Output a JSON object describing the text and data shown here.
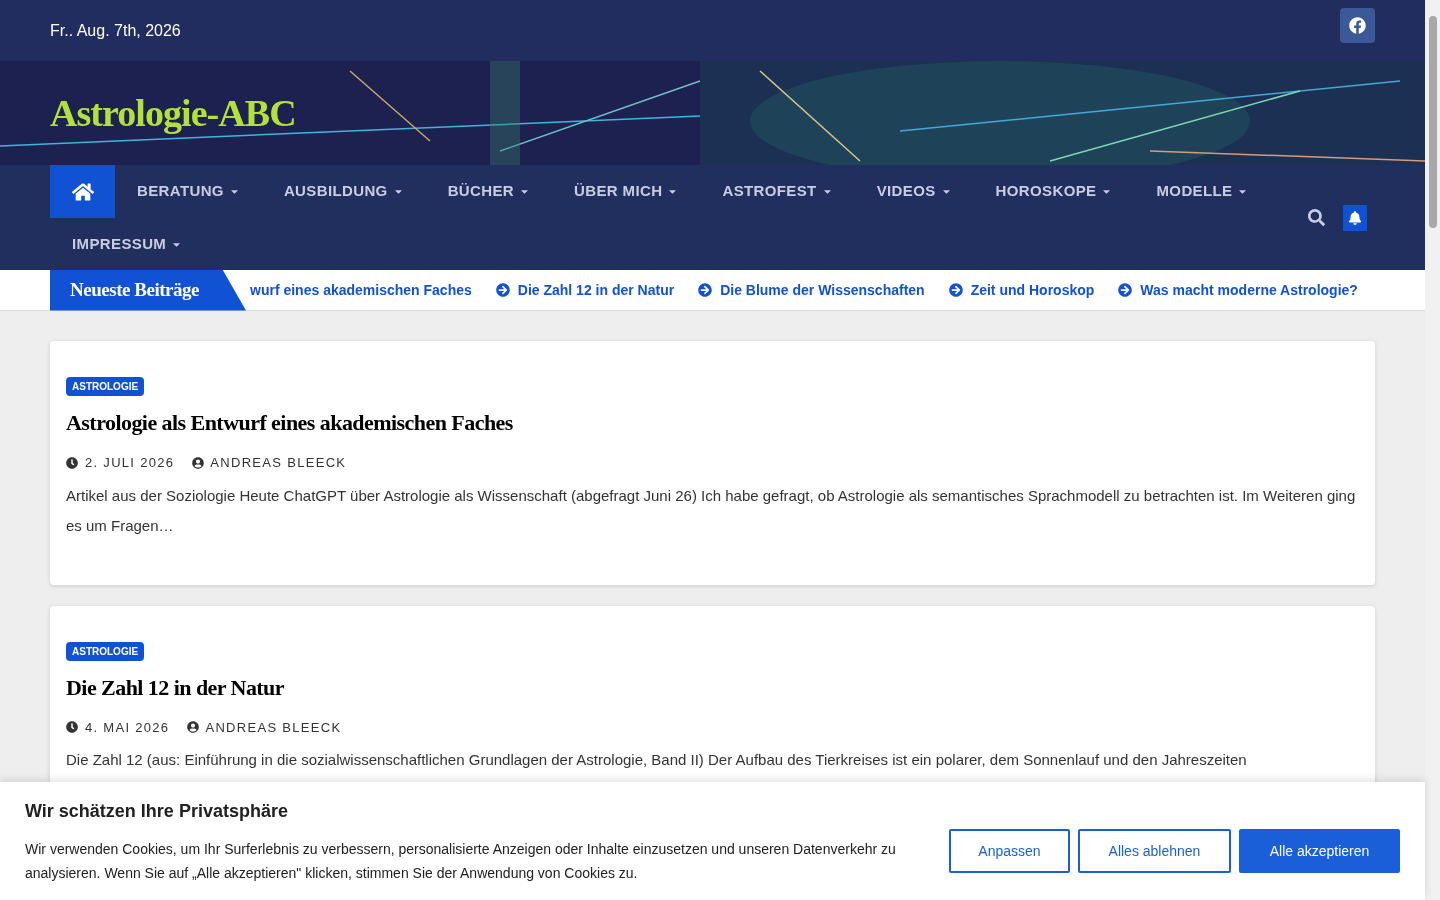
{
  "top_bar": {
    "date": "Fr.. Aug. 7th, 2026"
  },
  "header": {
    "site_title": "Astrologie-ABC"
  },
  "nav": {
    "items": [
      {
        "label": "BERATUNG",
        "has_dropdown": true
      },
      {
        "label": "AUSBILDUNG",
        "has_dropdown": true
      },
      {
        "label": "BÜCHER",
        "has_dropdown": true
      },
      {
        "label": "ÜBER MICH",
        "has_dropdown": true
      },
      {
        "label": "ASTROFEST",
        "has_dropdown": true
      },
      {
        "label": "VIDEOS",
        "has_dropdown": true
      },
      {
        "label": "HOROSKOPE",
        "has_dropdown": true
      },
      {
        "label": "MODELLE",
        "has_dropdown": true
      },
      {
        "label": "IMPRESSUM",
        "has_dropdown": true
      }
    ]
  },
  "ticker": {
    "label": "Neueste Beiträge",
    "items": [
      {
        "text": "wurf eines akademischen Faches",
        "arrow": false
      },
      {
        "text": "Die Zahl 12 in der Natur",
        "arrow": true
      },
      {
        "text": "Die Blume der Wissenschaften",
        "arrow": true
      },
      {
        "text": "Zeit und Horoskop",
        "arrow": true
      },
      {
        "text": "Was macht moderne Astrologie?",
        "arrow": true
      }
    ]
  },
  "posts": [
    {
      "category": "ASTROLOGIE",
      "title": "Astrologie als Entwurf eines akademischen Faches",
      "date": "2. JULI 2026",
      "author": "ANDREAS BLEECK",
      "excerpt": "Artikel aus der Soziologie Heute ChatGPT über Astrologie als Wissenschaft (abgefragt Juni 26) Ich habe gefragt, ob Astrologie als semantisches Sprachmodell zu betrachten ist. Im Weiteren ging es um Fragen…"
    },
    {
      "category": "ASTROLOGIE",
      "title": "Die Zahl 12 in der Natur",
      "date": "4. MAI 2026",
      "author": "ANDREAS BLEECK",
      "excerpt": "Die Zahl 12 (aus: Einführung in die sozialwissenschaftlichen Grundlagen der Astrologie, Band II) Der Aufbau des Tierkreises ist ein polarer, dem Sonnenlauf und den Jahreszeiten"
    }
  ],
  "cookie_banner": {
    "title": "Wir schätzen Ihre Privatsphäre",
    "text": "Wir verwenden Cookies, um Ihr Surferlebnis zu verbessern, personalisierte Anzeigen oder Inhalte einzusetzen und unseren Datenverkehr zu analysieren. Wenn Sie auf „Alle akzeptieren\" klicken, stimmen Sie der Anwendung von Cookies zu.",
    "buttons": [
      {
        "label": "Anpassen",
        "kind": "outline"
      },
      {
        "label": "Alles ablehnen",
        "kind": "outline"
      },
      {
        "label": "Alle akzeptieren",
        "kind": "primary"
      }
    ]
  }
}
